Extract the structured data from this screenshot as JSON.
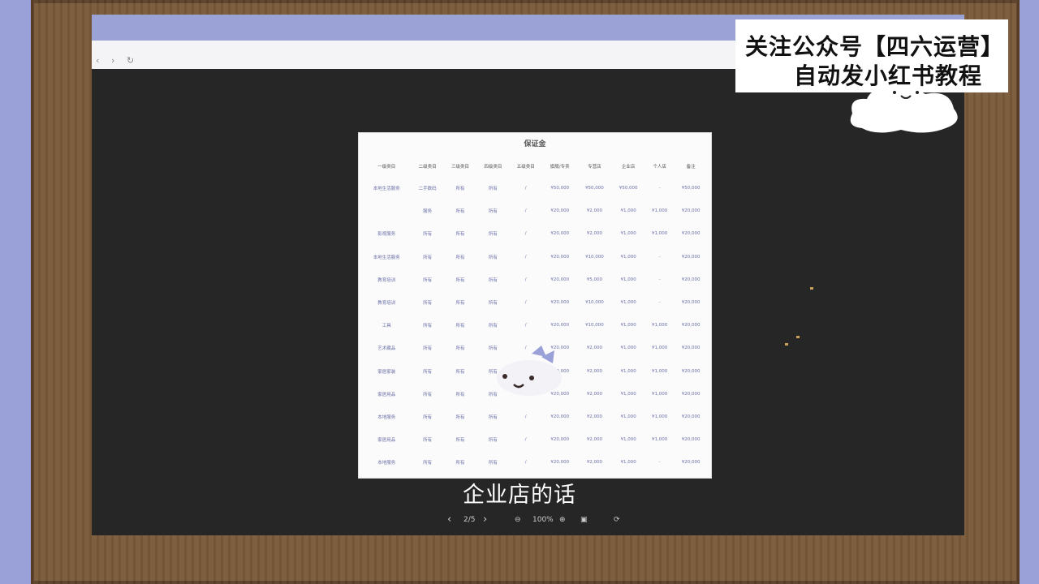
{
  "browser": {
    "back_icon": "chevron-left-icon",
    "forward_icon": "chevron-right-icon",
    "reload_icon": "reload-icon"
  },
  "document": {
    "title": "保证金",
    "headers": [
      "一级类目",
      "二级类目",
      "三级类目",
      "四级类目",
      "五级类目",
      "旗舰/专卖",
      "专营店",
      "企业店",
      "个人店",
      "备注"
    ],
    "rows": [
      [
        "本地生活服务",
        "二手数码",
        "所有",
        "所有",
        "/",
        "¥50,000",
        "¥50,000",
        "¥50,000",
        "-",
        "¥50,000"
      ],
      [
        "",
        "服务",
        "所有",
        "所有",
        "/",
        "¥20,000",
        "¥2,000",
        "¥1,000",
        "¥1,000",
        "¥20,000"
      ],
      [
        "影视服务",
        "所有",
        "所有",
        "所有",
        "/",
        "¥20,000",
        "¥2,000",
        "¥1,000",
        "¥1,000",
        "¥20,000"
      ],
      [
        "本地生活服务",
        "所有",
        "所有",
        "所有",
        "/",
        "¥20,000",
        "¥10,000",
        "¥1,000",
        "-",
        "¥20,000"
      ],
      [
        "教育培训",
        "所有",
        "所有",
        "所有",
        "/",
        "¥20,000",
        "¥5,000",
        "¥1,000",
        "-",
        "¥20,000"
      ],
      [
        "教育培训",
        "所有",
        "所有",
        "所有",
        "/",
        "¥20,000",
        "¥10,000",
        "¥1,000",
        "-",
        "¥20,000"
      ],
      [
        "工具",
        "所有",
        "所有",
        "所有",
        "/",
        "¥20,000",
        "¥10,000",
        "¥1,000",
        "¥1,000",
        "¥20,000"
      ],
      [
        "艺术藏品",
        "所有",
        "所有",
        "所有",
        "/",
        "¥20,000",
        "¥2,000",
        "¥1,000",
        "¥1,000",
        "¥20,000"
      ],
      [
        "家居家装",
        "所有",
        "所有",
        "所有",
        "/",
        "¥20,000",
        "¥2,000",
        "¥1,000",
        "¥1,000",
        "¥20,000"
      ],
      [
        "家居用品",
        "所有",
        "所有",
        "所有",
        "/",
        "¥20,000",
        "¥2,000",
        "¥1,000",
        "¥1,000",
        "¥20,000"
      ],
      [
        "本地服务",
        "所有",
        "所有",
        "所有",
        "/",
        "¥20,000",
        "¥2,000",
        "¥1,000",
        "¥1,000",
        "¥20,000"
      ],
      [
        "家居用品",
        "所有",
        "所有",
        "所有",
        "/",
        "¥20,000",
        "¥2,000",
        "¥1,000",
        "¥1,000",
        "¥20,000"
      ],
      [
        "本地服务",
        "所有",
        "所有",
        "所有",
        "/",
        "¥20,000",
        "¥2,000",
        "¥1,000",
        "-",
        "¥20,000"
      ]
    ]
  },
  "viewer": {
    "page_indicator": "2/5",
    "zoom_level": "100%",
    "prev_icon": "chevron-left-icon",
    "next_icon": "chevron-right-icon",
    "zoom_out_icon": "zoom-out-icon",
    "zoom_in_icon": "zoom-in-icon",
    "fit_icon": "fit-page-icon",
    "rotate_icon": "rotate-icon"
  },
  "subtitle": "企业店的话",
  "banner": {
    "line1": "关注公众号【四六运营】",
    "line2": "自动发小红书教程"
  }
}
